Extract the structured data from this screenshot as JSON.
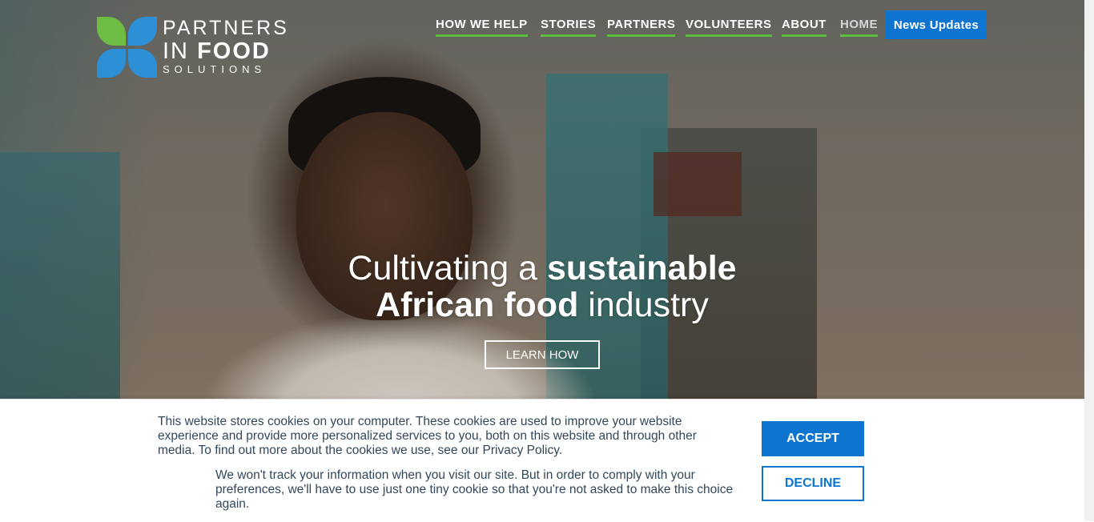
{
  "logo": {
    "line1": "PARTNERS",
    "line2_light": "IN ",
    "line2_bold": "FOOD",
    "line3": "SOLUTIONS"
  },
  "nav": {
    "items": [
      {
        "label": "HOW WE HELP"
      },
      {
        "label": "STORIES"
      },
      {
        "label": "PARTNERS"
      },
      {
        "label": "VOLUNTEERS"
      },
      {
        "label": "ABOUT"
      },
      {
        "label": "HOME"
      }
    ],
    "news_button": "News Updates"
  },
  "hero": {
    "headline_part1": "Cultivating a ",
    "headline_bold1": "sustainable",
    "headline_bold2": "African food",
    "headline_part2": " industry",
    "cta": "LEARN HOW"
  },
  "cookie_banner": {
    "text1": "This website stores cookies on your computer. These cookies are used to improve your website experience and provide more personalized services to you, both on this website and through other media. To find out more about the cookies we use, see our Privacy Policy.",
    "text2": "We won't track your information when you visit our site. But in order to comply with your preferences, we'll have to use just one tiny cookie so that you're not asked to make this choice again.",
    "accept": "ACCEPT",
    "decline": "DECLINE"
  },
  "colors": {
    "accent_blue": "#0d74d0",
    "accent_green": "#5cbf3c"
  }
}
